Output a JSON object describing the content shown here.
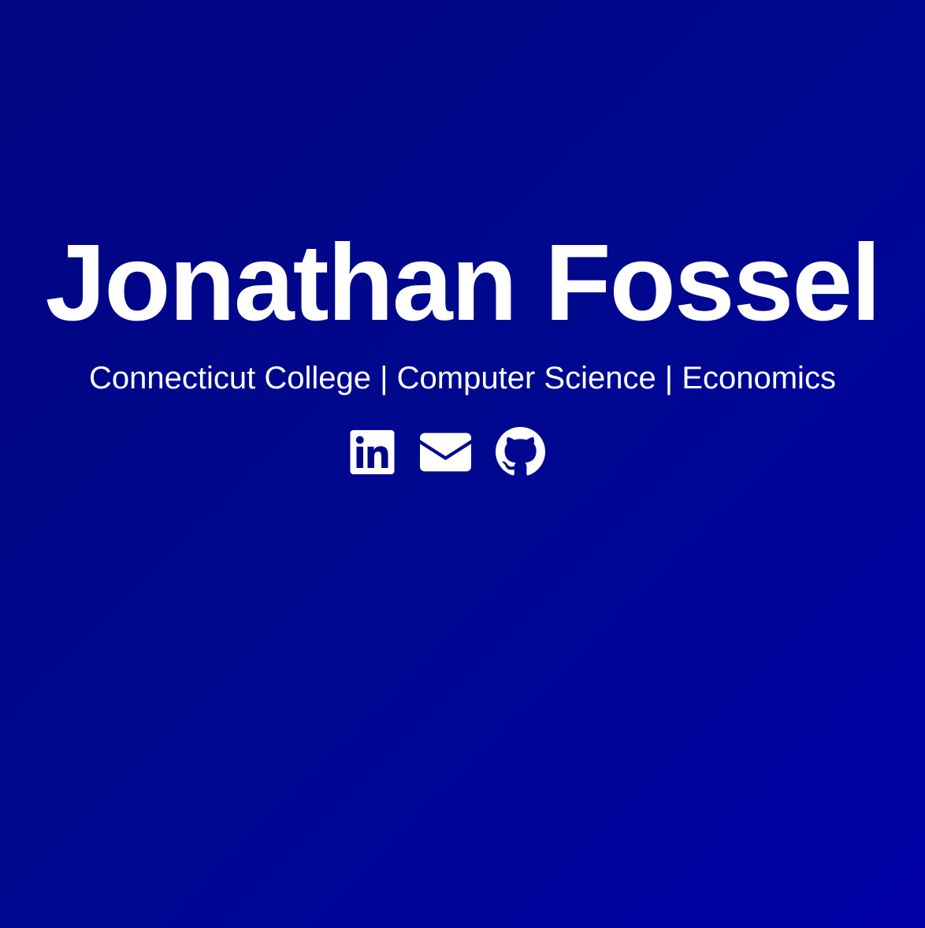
{
  "profile": {
    "name": "Jonathan Fossel",
    "tagline": "Connecticut College | Computer Science | Economics"
  },
  "socials": [
    {
      "icon": "linkedin-icon",
      "label": "LinkedIn"
    },
    {
      "icon": "envelope-icon",
      "label": "Email"
    },
    {
      "icon": "github-icon",
      "label": "GitHub"
    }
  ],
  "colors": {
    "background_start": "#000580",
    "background_end": "#0000a6",
    "text": "#ffffff"
  }
}
